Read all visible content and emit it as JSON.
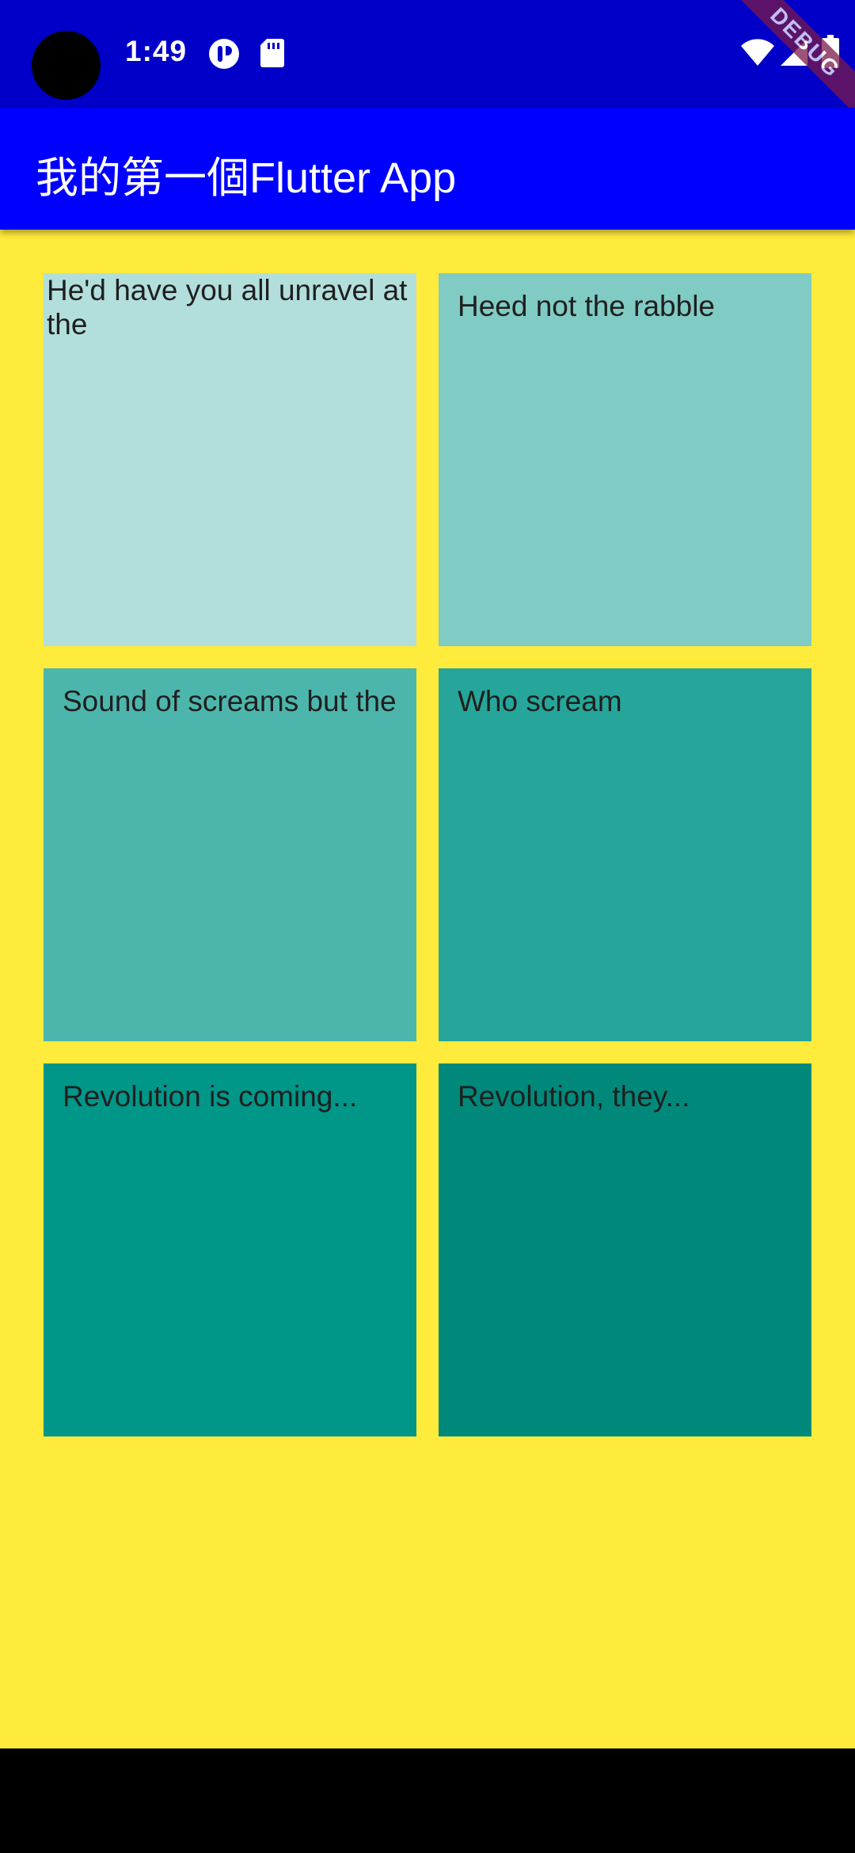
{
  "status_bar": {
    "time": "1:49",
    "icons": [
      "circle-p-icon",
      "sd-card-icon",
      "wifi-icon",
      "signal-icon",
      "battery-icon"
    ]
  },
  "debug_banner": "DEBUG",
  "app_bar": {
    "title": "我的第一個Flutter App"
  },
  "colors": {
    "status_bar": "#0000c8",
    "app_bar": "#0000ff",
    "background": "#ffeb3b",
    "debug_banner": "#7a1a4a"
  },
  "tiles": [
    {
      "text": "He'd have you all unravel at the",
      "color": "#b2dfdb"
    },
    {
      "text": "Heed not the rabble",
      "color": "#80cbc4"
    },
    {
      "text": "Sound of screams but the",
      "color": "#4db6ac"
    },
    {
      "text": "Who scream",
      "color": "#26a69a"
    },
    {
      "text": "Revolution is coming...",
      "color": "#009688"
    },
    {
      "text": "Revolution, they...",
      "color": "#00897b"
    }
  ]
}
